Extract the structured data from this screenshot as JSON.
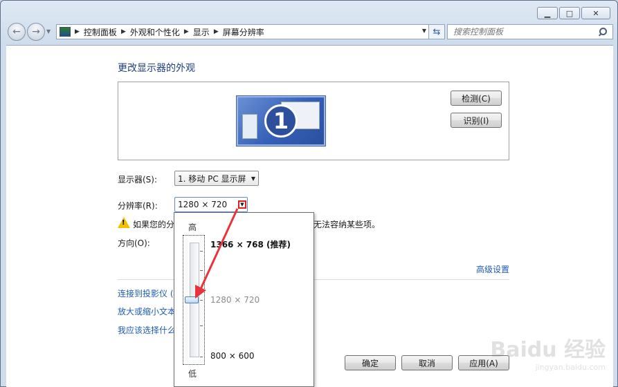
{
  "breadcrumb": [
    "控制面板",
    "外观和个性化",
    "显示",
    "屏幕分辨率"
  ],
  "search": {
    "placeholder": "搜索控制面板"
  },
  "page": {
    "title": "更改显示器的外观"
  },
  "preview": {
    "monitor_number": "1",
    "detect_label": "检测(C)",
    "identify_label": "识别(I)"
  },
  "display": {
    "label": "显示器(S):",
    "value": "1. 移动 PC 显示屏"
  },
  "resolution": {
    "label": "分辨率(R):",
    "value": "1280 × 720",
    "options": [
      "1366 × 768 (推荐)",
      "1280 × 720",
      "800 × 600"
    ],
    "high_label": "高",
    "low_label": "低"
  },
  "warning": {
    "text_left": "如果您的分",
    "text_right": "无法容纳某些项。"
  },
  "orientation": {
    "label": "方向(O):"
  },
  "advanced_link": "高级设置",
  "links": [
    "连接到投影仪 (",
    "放大或缩小文本",
    "我应该选择什么"
  ],
  "buttons": {
    "ok": "确定",
    "cancel": "取消",
    "apply": "应用(A)"
  },
  "watermark": {
    "brand": "Baidu 经验",
    "url": "jingyan.baidu.com"
  }
}
